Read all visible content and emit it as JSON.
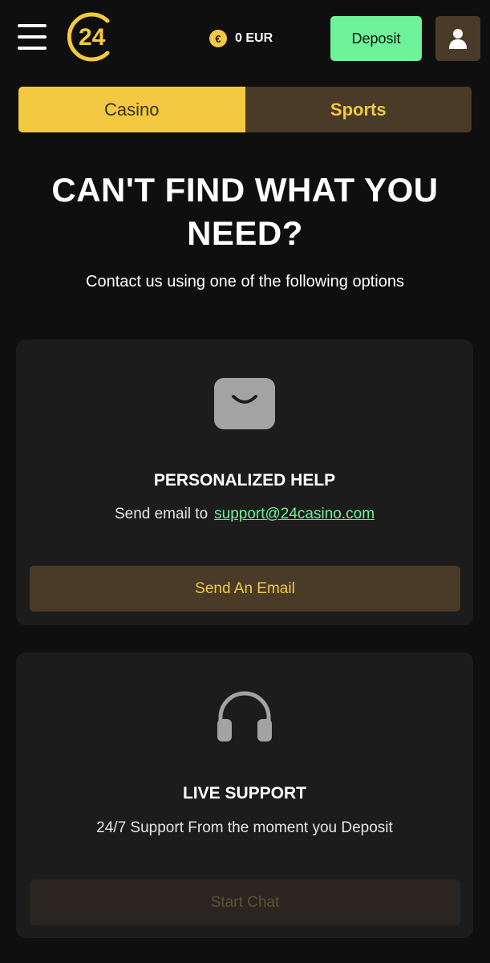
{
  "header": {
    "logo_text": "24",
    "balance": {
      "currency_symbol": "€",
      "amount": "0 EUR"
    },
    "deposit_label": "Deposit"
  },
  "tabs": [
    {
      "label": "Casino",
      "active": true
    },
    {
      "label": "Sports",
      "active": false
    }
  ],
  "main": {
    "title_line1": "CAN'T FIND WHAT YOU",
    "title_line2": "NEED?",
    "subtitle": "Contact us using one of the following options"
  },
  "cards": {
    "email": {
      "icon": "envelope-icon",
      "title": "PERSONALIZED HELP",
      "text_prefix": "Send email to",
      "email": "support@24casino.com",
      "button_label": "Send An Email"
    },
    "chat": {
      "icon": "headphones-icon",
      "title": "LIVE SUPPORT",
      "text": "24/7 Support From the moment you Deposit",
      "button_label": "Start Chat"
    }
  },
  "colors": {
    "accent_yellow": "#f2c940",
    "accent_green": "#6ef29a",
    "brown": "#4a3a28",
    "background": "#0f0f0f",
    "card": "#1c1c1c"
  }
}
